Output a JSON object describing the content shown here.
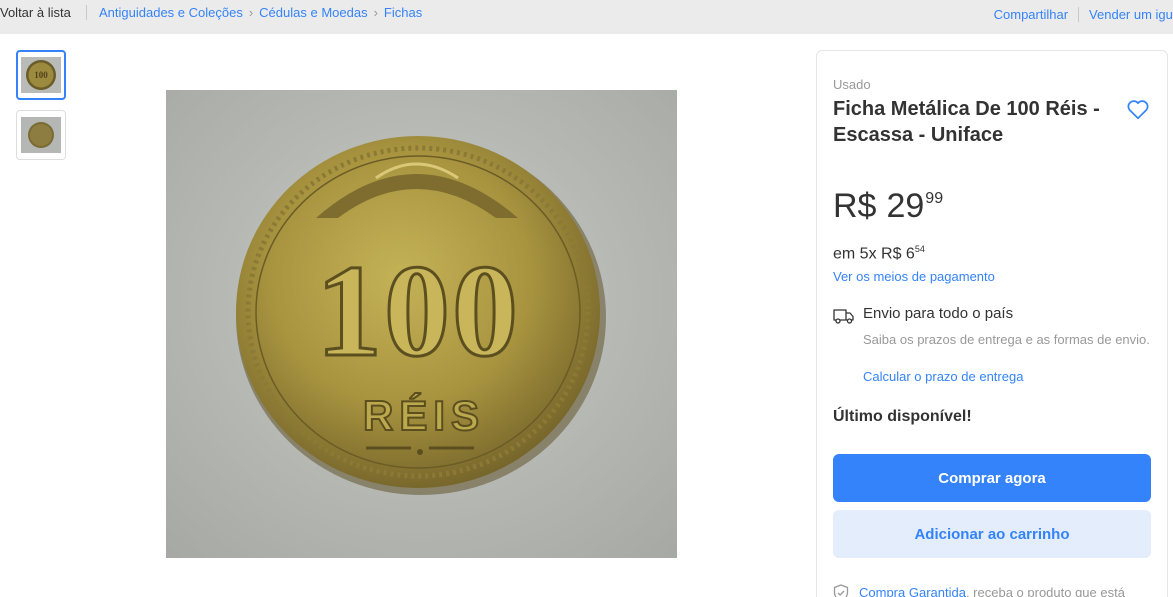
{
  "breadcrumb": {
    "back": "Voltar à lista",
    "items": [
      "Antiguidades e Coleções",
      "Cédulas e Moedas",
      "Fichas"
    ]
  },
  "header_actions": {
    "share": "Compartilhar",
    "sell": "Vender um igual"
  },
  "gallery": {
    "thumb_text": "100",
    "coin_value": "100",
    "coin_unit": "RÉIS"
  },
  "product": {
    "condition": "Usado",
    "title": "Ficha Metálica De 100 Réis - Escassa - Uniface",
    "currency": "R$",
    "price_whole": "29",
    "price_cents": "99",
    "installments_prefix": "em 5x R$ 6",
    "installments_cents": "54",
    "payment_link": "Ver os meios de pagamento"
  },
  "shipping": {
    "title": "Envio para todo o país",
    "description": "Saiba os prazos de entrega e as formas de envio.",
    "link": "Calcular o prazo de entrega"
  },
  "stock": "Último disponível!",
  "buttons": {
    "buy_now": "Comprar agora",
    "add_to_cart": "Adicionar ao carrinho"
  },
  "guarantee": {
    "link": "Compra Garantida",
    "text": ", receba o produto que está esperando ou devolvemos o dinheiro."
  },
  "colors": {
    "accent": "#3483fa",
    "accent_light": "#e3edfb",
    "background": "#ebebeb",
    "coin": "#a8943f"
  },
  "icons": [
    "heart-icon",
    "truck-icon",
    "shield-check-icon",
    "chevron-right-icon"
  ]
}
